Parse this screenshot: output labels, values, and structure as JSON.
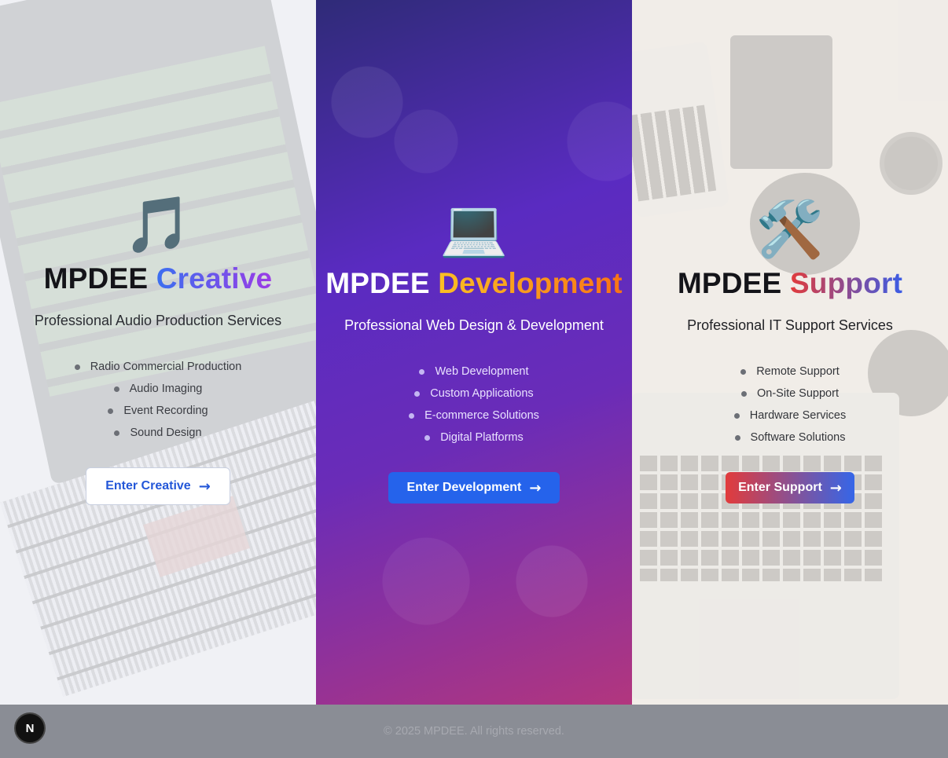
{
  "panels": {
    "creative": {
      "icon": "🎵",
      "icon_name": "music-notes-icon",
      "title_brand": "MPDEE",
      "title_accent": "Creative",
      "subtitle": "Professional Audio Production Services",
      "features": [
        "Radio Commercial Production",
        "Audio Imaging",
        "Event Recording",
        "Sound Design"
      ],
      "cta_label": "Enter Creative",
      "cta_arrow": "→"
    },
    "development": {
      "icon": "💻",
      "icon_name": "laptop-icon",
      "title_brand": "MPDEE",
      "title_accent": "Development",
      "subtitle": "Professional Web Design & Development",
      "features": [
        "Web Development",
        "Custom Applications",
        "E-commerce Solutions",
        "Digital Platforms"
      ],
      "cta_label": "Enter Development",
      "cta_arrow": "→"
    },
    "support": {
      "icon": "🛠️",
      "icon_name": "hammer-wrench-icon",
      "title_brand": "MPDEE",
      "title_accent": "Support",
      "subtitle": "Professional IT Support Services",
      "features": [
        "Remote Support",
        "On-Site Support",
        "Hardware Services",
        "Software Solutions"
      ],
      "cta_label": "Enter Support",
      "cta_arrow": "→"
    }
  },
  "footer": {
    "copyright": "© 2025 MPDEE. All rights reserved."
  },
  "dev_badge": {
    "label": "N",
    "icon_name": "nextjs-badge-icon"
  },
  "colors": {
    "accent_blue": "#2563eb",
    "dev_gradient_start": "#2f2b78",
    "dev_gradient_end": "#b2367e",
    "footer_bg": "#8a8d95"
  }
}
